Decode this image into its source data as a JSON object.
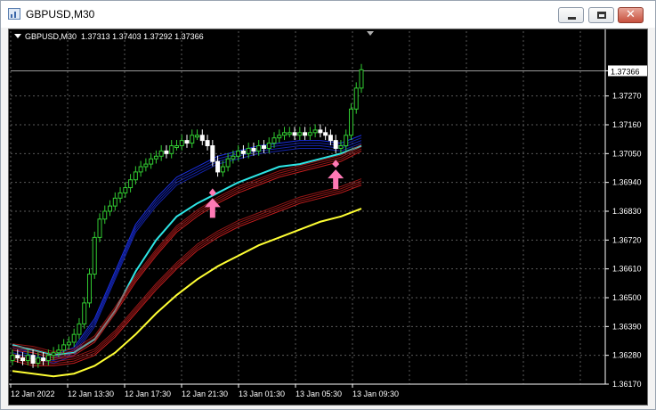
{
  "window": {
    "title": "GBPUSD,M30",
    "buttons": {
      "minimize": "minimize",
      "maximize": "maximize",
      "close": "close"
    }
  },
  "chart_header": {
    "symbol": "GBPUSD,M30",
    "ohlc": "1.37313 1.37403 1.37292 1.37366"
  },
  "current_price_label": "1.37366",
  "colors": {
    "background": "#000000",
    "grid": "#5a5a5a",
    "axis_text": "#ffffff",
    "bull_candle": "#32cd32",
    "bear_candle": "#ffffff",
    "blue_bands": "#1a2fe0",
    "cyan_line": "#2ee6e6",
    "red_bands": "#c41e1e",
    "yellow_line": "#ffff33",
    "arrow": "#ff79b5"
  },
  "chart_data": {
    "type": "candlestick",
    "x_tick_labels": [
      "12 Jan 2022",
      "12 Jan 13:30",
      "12 Jan 17:30",
      "12 Jan 21:30",
      "13 Jan 01:30",
      "13 Jan 05:30",
      "13 Jan 09:30"
    ],
    "y_tick_labels": [
      "1.37366",
      "1.37270",
      "1.37160",
      "1.37050",
      "1.36940",
      "1.36830",
      "1.36720",
      "1.36610",
      "1.36500",
      "1.36390",
      "1.36280",
      "1.36170"
    ],
    "ylim": [
      1.3617,
      1.3749
    ],
    "grid": true,
    "candles_close": [
      1.3628,
      1.3627,
      1.3626,
      1.3628,
      1.3625,
      1.3627,
      1.3626,
      1.3628,
      1.3629,
      1.363,
      1.3632,
      1.3633,
      1.3636,
      1.364,
      1.3648,
      1.3659,
      1.3673,
      1.368,
      1.3683,
      1.3685,
      1.3688,
      1.369,
      1.3692,
      1.3695,
      1.3698,
      1.37,
      1.3701,
      1.3703,
      1.3704,
      1.3706,
      1.3705,
      1.3708,
      1.3708,
      1.371,
      1.3709,
      1.3712,
      1.3712,
      1.371,
      1.3708,
      1.3702,
      1.3698,
      1.37,
      1.3703,
      1.3704,
      1.3706,
      1.3705,
      1.3707,
      1.3706,
      1.3708,
      1.3707,
      1.3709,
      1.3711,
      1.3712,
      1.3713,
      1.3713,
      1.3712,
      1.3713,
      1.3712,
      1.3713,
      1.3714,
      1.3713,
      1.3712,
      1.371,
      1.3707,
      1.3708,
      1.3712,
      1.3722,
      1.373,
      1.3737
    ],
    "signal_arrows": [
      {
        "type": "buy",
        "price": 1.369
      },
      {
        "type": "buy",
        "price": 1.3701
      }
    ],
    "series": [
      {
        "values": [
          1.3632,
          1.363,
          1.3628,
          1.3631,
          1.3642,
          1.366,
          1.3678,
          1.3688,
          1.3696,
          1.37,
          1.3704,
          1.3706,
          1.3708,
          1.3709,
          1.371,
          1.371,
          1.3709,
          1.3712
        ]
      },
      {
        "values": [
          1.3632,
          1.363,
          1.3628,
          1.3629,
          1.3634,
          1.3645,
          1.366,
          1.3672,
          1.3681,
          1.3686,
          1.369,
          1.3694,
          1.3697,
          1.37,
          1.3701,
          1.3703,
          1.3705,
          1.3708
        ]
      },
      {
        "values": [
          1.363,
          1.3629,
          1.3627,
          1.3628,
          1.3633,
          1.3644,
          1.3656,
          1.3666,
          1.3675,
          1.3681,
          1.3686,
          1.369,
          1.3693,
          1.3696,
          1.3698,
          1.37,
          1.3702,
          1.3706
        ]
      },
      {
        "values": [
          1.3626,
          1.3624,
          1.3624,
          1.3625,
          1.3628,
          1.3635,
          1.3644,
          1.3653,
          1.3661,
          1.3668,
          1.3673,
          1.3677,
          1.368,
          1.3683,
          1.3686,
          1.3688,
          1.369,
          1.3693
        ]
      },
      {
        "values": [
          1.3622,
          1.3621,
          1.362,
          1.3621,
          1.3624,
          1.3629,
          1.3636,
          1.3644,
          1.3651,
          1.3657,
          1.3662,
          1.3666,
          1.367,
          1.3673,
          1.3676,
          1.3679,
          1.3681,
          1.3684
        ]
      }
    ]
  }
}
